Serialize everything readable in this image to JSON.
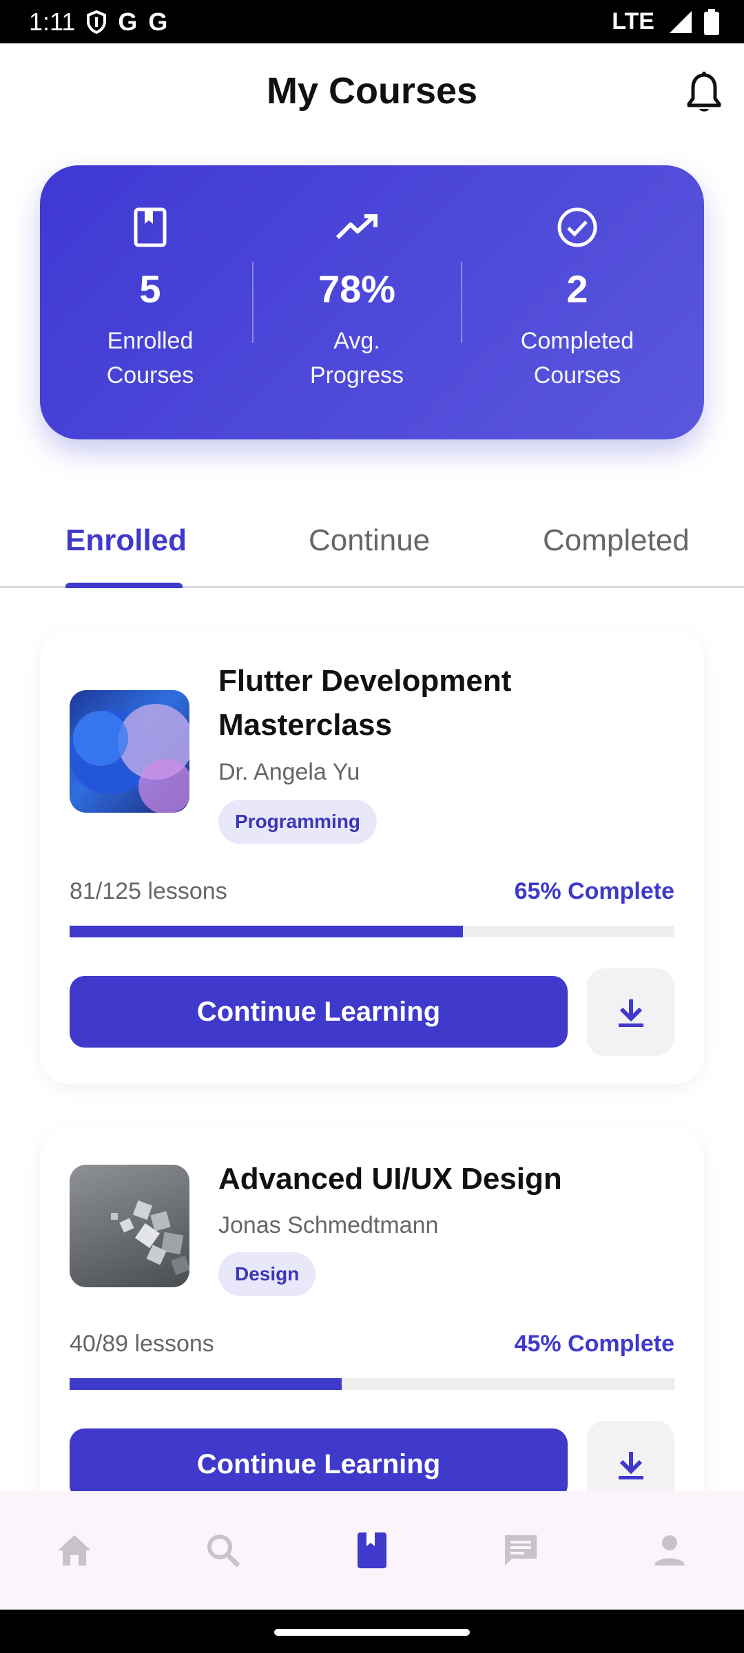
{
  "status_bar": {
    "time": "1:11",
    "g1": "G",
    "g2": "G",
    "network": "LTE"
  },
  "header": {
    "title": "My Courses"
  },
  "stats": [
    {
      "icon": "book-icon",
      "value": "5",
      "label_line1": "Enrolled",
      "label_line2": "Courses"
    },
    {
      "icon": "trending-up-icon",
      "value": "78%",
      "label_line1": "Avg.",
      "label_line2": "Progress"
    },
    {
      "icon": "check-circle-icon",
      "value": "2",
      "label_line1": "Completed",
      "label_line2": "Courses"
    }
  ],
  "tabs": [
    {
      "label": "Enrolled",
      "active": true
    },
    {
      "label": "Continue",
      "active": false
    },
    {
      "label": "Completed",
      "active": false
    }
  ],
  "courses": [
    {
      "title_line1": "Flutter Development",
      "title_line2": "Masterclass",
      "instructor": "Dr. Angela Yu",
      "tag": "Programming",
      "lessons": "81/125 lessons",
      "complete_label": "65% Complete",
      "progress": 0.65,
      "button_label": "Continue Learning"
    },
    {
      "title_line1": "Advanced UI/UX Design",
      "instructor": "Jonas Schmedtmann",
      "tag": "Design",
      "lessons": "40/89 lessons",
      "complete_label": "45% Complete",
      "progress": 0.45,
      "button_label": "Continue Learning"
    }
  ],
  "bottom_nav": [
    {
      "icon": "home-icon",
      "active": false
    },
    {
      "icon": "search-icon",
      "active": false
    },
    {
      "icon": "book-icon",
      "active": true
    },
    {
      "icon": "chat-icon",
      "active": false
    },
    {
      "icon": "profile-icon",
      "active": false
    }
  ],
  "colors": {
    "accent": "#3f39cc",
    "card_gradient_start": "#3f39d3",
    "card_gradient_end": "#5a57de",
    "tag_bg": "#e9e8fb",
    "nav_bg": "#fcf4fb"
  }
}
